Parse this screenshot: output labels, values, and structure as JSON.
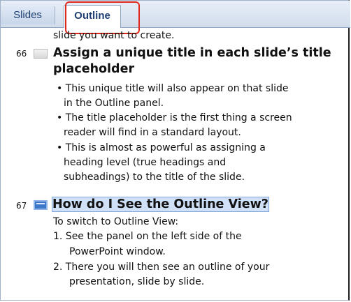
{
  "tabs": {
    "slides": "Slides",
    "outline": "Outline"
  },
  "cut_text": "slide you want to create.",
  "slide66": {
    "number": "66",
    "title_line1": "Assign a unique title in each slide’s title",
    "title_line2": "placeholder",
    "bullets": [
      "• This unique title will also appear on that slide",
      "in the Outline panel.",
      "• The title placeholder is the first thing a screen",
      "reader will find in a standard layout.",
      "• This is almost  as powerful as assigning a",
      "heading level (true headings and",
      "subheadings) to the title of the slide."
    ]
  },
  "slide67": {
    "number": "67",
    "title": "How do I See the Outline View?",
    "lines": [
      "To switch to Outline View:",
      "1. See the panel on the left side of the",
      "PowerPoint window.",
      "2. There you will then see an outline of your",
      "presentation, slide by slide."
    ]
  }
}
